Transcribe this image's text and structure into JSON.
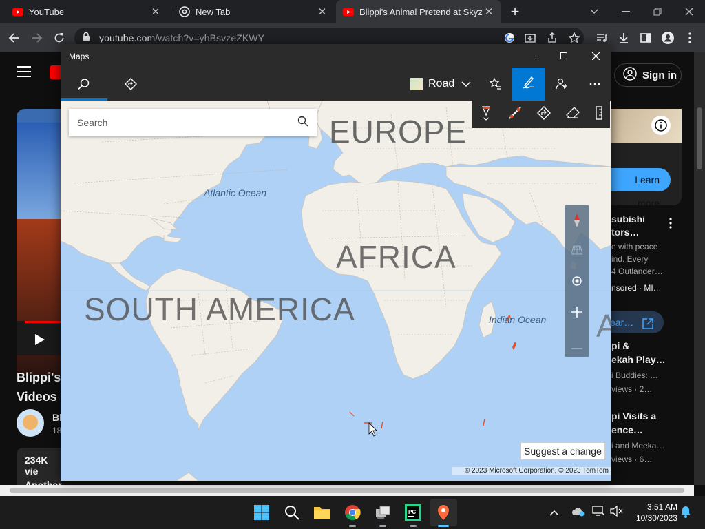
{
  "browser": {
    "tabs": [
      {
        "title": "YouTube"
      },
      {
        "title": "New Tab"
      },
      {
        "title": "Blippi's Animal Pretend at Skyzone"
      }
    ],
    "url_host": "youtube.com",
    "url_path": "/watch?v=yhBsvzeZKWY"
  },
  "youtube": {
    "sign_in": "Sign in",
    "video_title_line1": "Blippi's",
    "video_title_line2": "Videos",
    "views": "234K vie",
    "another": "Another",
    "channel_initial": "Bl",
    "channel_sub": "18",
    "ad_learn_more": "Learn more",
    "sidebar": [
      {
        "title1": "subishi",
        "title2": "tors…",
        "meta1": "e with peace",
        "meta2": "ind. Every",
        "meta3": "4 Outlander…",
        "meta4": "nsored · MI…"
      },
      {
        "title1": "pi &",
        "title2": "ekah Play…",
        "meta1": "i Buddies: …",
        "meta2": "views · 2…"
      },
      {
        "title1": "pi Visits a",
        "title2": "ence…",
        "meta1": "i and Meeka…",
        "meta2": "views · 6…"
      }
    ],
    "learn_btn": "ear…"
  },
  "maps": {
    "window_title": "Maps",
    "map_style": "Road",
    "search_placeholder": "Search",
    "labels": {
      "europe": "EUROPE",
      "africa": "AFRICA",
      "south_america": "SOUTH AMERICA",
      "asia_partial": "AU",
      "atlantic": "Atlantic Ocean",
      "indian": "Indian Ocean"
    },
    "suggest_change": "Suggest a change",
    "copyright": "© 2023 Microsoft Corporation, © 2023 TomTom"
  },
  "taskbar": {
    "time": "3:51 AM",
    "date": "10/30/2023"
  },
  "colors": {
    "ocean": "#aed1f5",
    "land": "#f2efe9",
    "accent": "#0078d4"
  }
}
